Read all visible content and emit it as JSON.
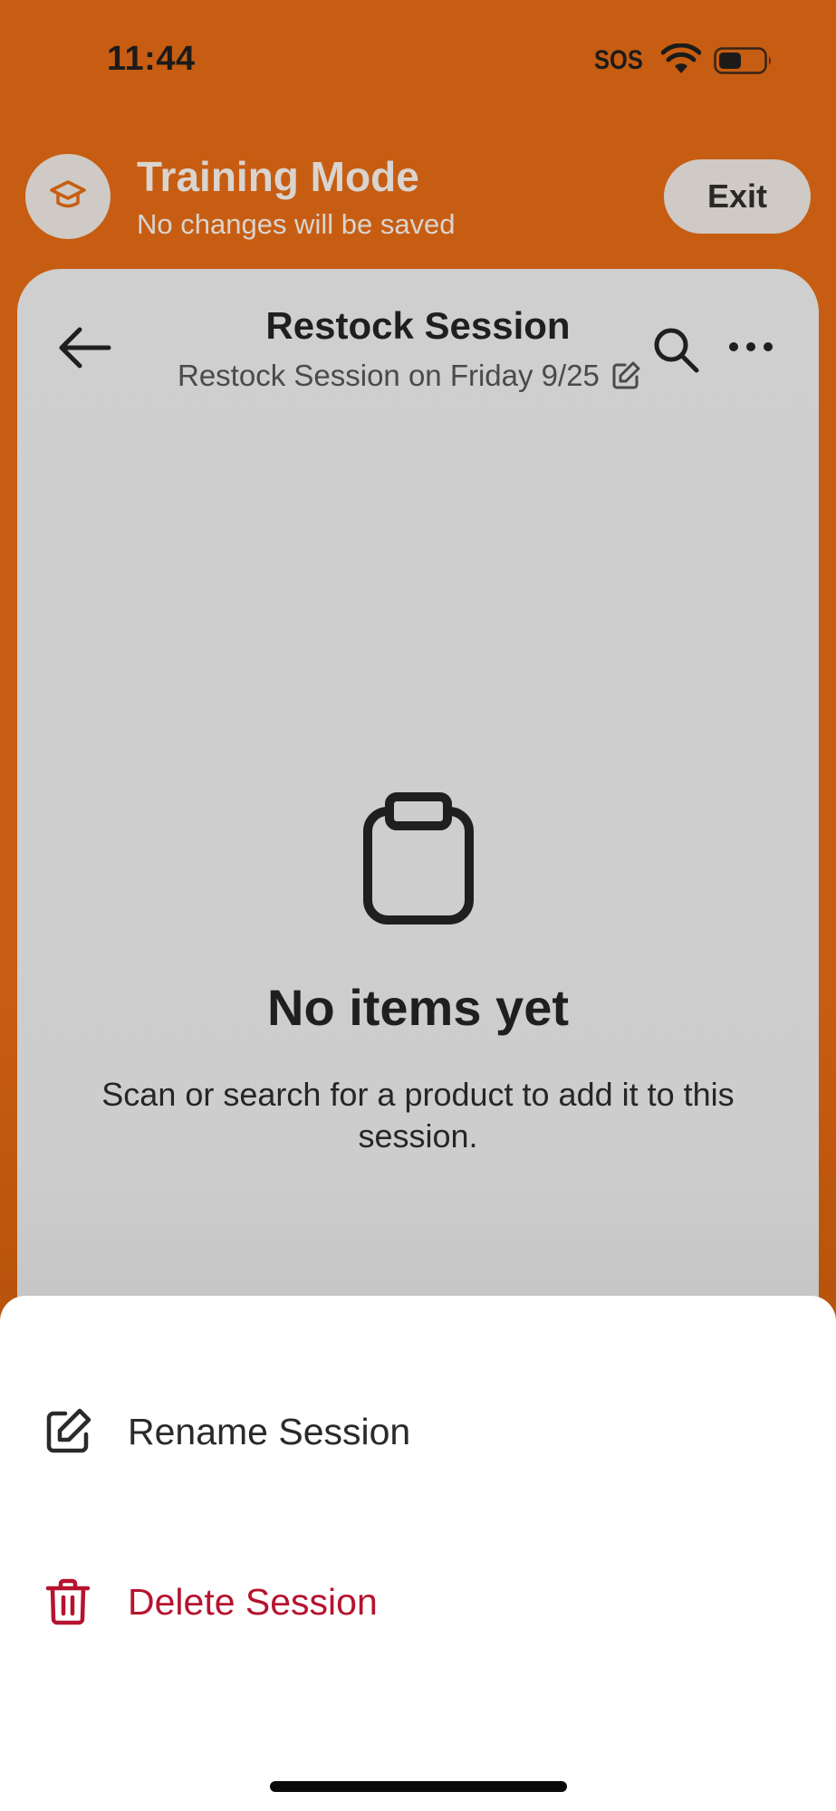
{
  "status_bar": {
    "time": "11:44",
    "carrier": "SOS",
    "wifi_icon": "wifi-icon",
    "battery_icon": "battery-icon"
  },
  "training": {
    "icon": "graduation-cap-icon",
    "title": "Training Mode",
    "subtitle": "No changes will be saved",
    "exit_label": "Exit"
  },
  "session": {
    "back_icon": "arrow-left-icon",
    "title": "Restock Session",
    "subtitle": "Restock Session on Friday 9/25",
    "edit_icon": "edit-icon",
    "search_icon": "search-icon",
    "more_icon": "more-horizontal-icon"
  },
  "empty_state": {
    "icon": "clipboard-icon",
    "title": "No items yet",
    "description": "Scan or search for a product to add it to this session."
  },
  "action_sheet": {
    "items": [
      {
        "label": "Rename Session",
        "icon": "edit-icon"
      },
      {
        "label": "Delete Session",
        "icon": "trash-icon",
        "color": "#b6132f"
      }
    ]
  },
  "colors": {
    "brand_orange": "#c75d12",
    "destructive": "#b6132f",
    "overlay_gray": "#cdcdcd"
  }
}
